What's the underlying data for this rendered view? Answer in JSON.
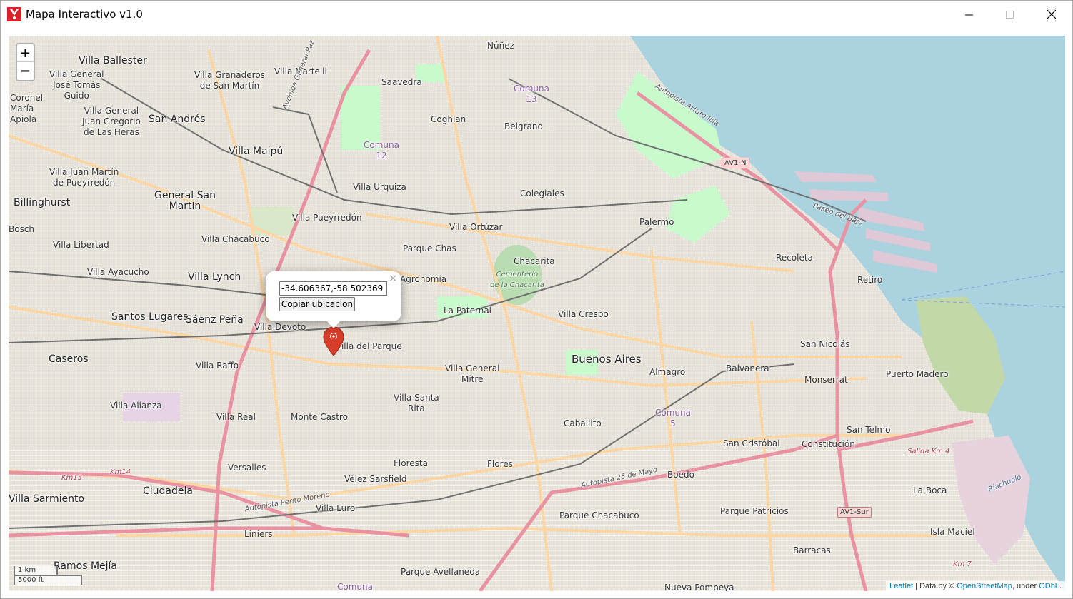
{
  "window": {
    "title": "Mapa Interactivo v1.0",
    "controls": {
      "minimize": "—",
      "maximize": "☐",
      "close": "✕"
    }
  },
  "zoom": {
    "in": "+",
    "out": "−"
  },
  "popup": {
    "coordinates": "-34.606367,-58.502369",
    "copy_label": "Copiar ubicacion",
    "close": "×"
  },
  "scale": {
    "metric": "1 km",
    "imperial": "5000 ft"
  },
  "attribution": {
    "leaflet": "Leaflet",
    "sep": " | Data by © ",
    "osm": "OpenStreetMap",
    "under": ", under ",
    "odbl": "ODbL",
    "end": "."
  },
  "colors": {
    "water": "#aad3df",
    "motorway": "#e892a2",
    "primary": "#fcd6a4",
    "park": "#c8facc",
    "marker": "#d63e2a"
  },
  "map_labels": {
    "villa_ballester": "Villa Ballester",
    "villa_general_jose_tomas_guido": "Villa General\nJosé Tomás\nGuido",
    "coronel_maria_apiola": "Coronel\nMaría\nApiola",
    "villa_granaderos": "Villa Granaderos\nde San Martín",
    "villa_martelli": "Villa Martelli",
    "nunez": "Núñez",
    "saavedra": "Saavedra",
    "comuna_13": "Comuna\n13",
    "villa_general_juan_gregorio": "Villa General\nJuan Gregorio\nde Las Heras",
    "san_andres": "San Andrés",
    "coghlan": "Coghlan",
    "belgrano": "Belgrano",
    "comuna_12": "Comuna\n12",
    "villa_maipu": "Villa Maipú",
    "villa_juan_martin": "Villa Juan Martín\nde Pueyrredón",
    "billinghurst": "Billinghurst",
    "general_san_martin": "General San\nMartín",
    "villa_urquiza": "Villa Urquiza",
    "colegiales": "Colegiales",
    "bosch": "Bosch",
    "villa_pueyrredon": "Villa Pueyrredón",
    "villa_chacabuco": "Villa Chacabuco",
    "villa_ortuzar": "Villa Ortúzar",
    "palermo": "Palermo",
    "villa_libertad": "Villa Libertad",
    "parque_chas": "Parque Chas",
    "chacarita": "Chacarita",
    "recoleta": "Recoleta",
    "villa_ayacucho": "Villa Ayacucho",
    "villa_lynch": "Villa Lynch",
    "agronomia": "Agronomía",
    "cementerio": "Cementerio\nde la Chacarita",
    "retiro": "Retiro",
    "santos_lugares": "Santos Lugares",
    "saenz_pena": "Sáenz Peña",
    "la_paternal": "La Paternal",
    "villa_crespo": "Villa Crespo",
    "villa_devoto": "Villa Devoto",
    "villa_del_parque": "Villa del Parque",
    "san_nicolas": "San Nicolás",
    "caseros": "Caseros",
    "buenos_aires": "Buenos Aires",
    "villa_raffo": "Villa Raffo",
    "villa_general_mitre": "Villa General\nMitre",
    "almagro": "Almagro",
    "balvanera": "Balvanera",
    "puerto_madero": "Puerto Madero",
    "monserrat": "Monserrat",
    "villa_santa_rita": "Villa Santa\nRita",
    "villa_alianza": "Villa Alianza",
    "villa_real": "Villa Real",
    "monte_castro": "Monte Castro",
    "comuna_5": "Comuna\n5",
    "caballito": "Caballito",
    "san_telmo": "San Telmo",
    "san_cristobal": "San Cristóbal",
    "constitucion": "Constitución",
    "floresta": "Floresta",
    "flores": "Flores",
    "versalles": "Versalles",
    "boedo": "Boedo",
    "velez_sarsfield": "Vélez Sarsfield",
    "la_boca": "La Boca",
    "ciudadela": "Ciudadela",
    "villa_sarmiento": "Villa Sarmiento",
    "villa_luro": "Villa Luro",
    "parque_chacabuco": "Parque Chacabuco",
    "parque_patricios": "Parque Patricios",
    "isla_maciel": "Isla Maciel",
    "liniers": "Liniers",
    "barracas": "Barracas",
    "ramos_mejia": "Ramos Mejía",
    "parque_avellaneda": "Parque Avellaneda",
    "nueva_pompeya": "Nueva Pompeya",
    "comuna_bottom": "Comuna",
    "av1n": "AV1-N",
    "av1sur": "AV1-Sur",
    "km14": "Km14",
    "km15": "Km15",
    "salida_km4": "Salida Km 4",
    "km7": "Km 7",
    "autopista_25_mayo": "Autopista 25 de Mayo",
    "autopista_perito_moreno": "Autopista Perito Moreno",
    "avenida_general_paz": "Avenida General Paz",
    "autopista_arturo_illia": "Autopista Arturo Illia",
    "paseo_del_bajo": "Paseo del Bajo",
    "riachuelo": "Riachuelo"
  }
}
